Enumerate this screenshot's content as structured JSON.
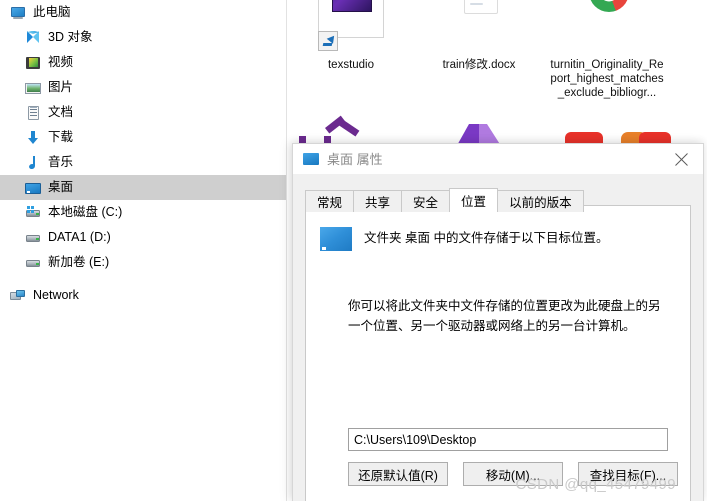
{
  "explorer": {
    "nav_pane": {
      "items": [
        {
          "label": "此电脑",
          "icon": "monitor-icon",
          "level": 0,
          "selected": false
        },
        {
          "label": "3D 对象",
          "icon": "cube-icon",
          "level": 1,
          "selected": false
        },
        {
          "label": "视频",
          "icon": "video-icon",
          "level": 1,
          "selected": false
        },
        {
          "label": "图片",
          "icon": "picture-icon",
          "level": 1,
          "selected": false
        },
        {
          "label": "文档",
          "icon": "document-icon",
          "level": 1,
          "selected": false
        },
        {
          "label": "下载",
          "icon": "download-icon",
          "level": 1,
          "selected": false
        },
        {
          "label": "音乐",
          "icon": "music-icon",
          "level": 1,
          "selected": false
        },
        {
          "label": "桌面",
          "icon": "desktop-icon",
          "level": 1,
          "selected": true
        },
        {
          "label": "本地磁盘 (C:)",
          "icon": "system-drive-icon",
          "level": 1,
          "selected": false
        },
        {
          "label": "DATA1 (D:)",
          "icon": "drive-icon",
          "level": 1,
          "selected": false
        },
        {
          "label": "新加卷 (E:)",
          "icon": "drive-icon",
          "level": 1,
          "selected": false
        },
        {
          "label": "Network",
          "icon": "network-icon",
          "level": 0,
          "selected": false
        }
      ]
    },
    "content_pane": {
      "files": [
        {
          "name": "texstudio",
          "icon": "texstudio-shortcut-icon",
          "selected": true
        },
        {
          "name": "train修改.docx",
          "icon": "word-document-icon",
          "selected": false
        },
        {
          "name": "turnitin_Originality_Report_highest_matches_exclude_bibliogr...",
          "icon": "chrome-html-document-icon",
          "selected": false
        }
      ]
    }
  },
  "dialog": {
    "title": "桌面 属性",
    "title_icon": "desktop-folder-icon",
    "close_label": "✕",
    "tabs": [
      {
        "label": "常规",
        "active": false
      },
      {
        "label": "共享",
        "active": false
      },
      {
        "label": "安全",
        "active": false
      },
      {
        "label": "位置",
        "active": true
      },
      {
        "label": "以前的版本",
        "active": false
      }
    ],
    "location": {
      "folder_icon": "desktop-folder-icon",
      "heading": "文件夹 桌面 中的文件存储于以下目标位置。",
      "description": "你可以将此文件夹中文件存储的位置更改为此硬盘上的另一个位置、另一个驱动器或网络上的另一台计算机。",
      "path_value": "C:\\Users\\109\\Desktop",
      "path_placeholder": "",
      "buttons": [
        {
          "label": "还原默认值(R)",
          "name": "restore-default-button"
        },
        {
          "label": "移动(M)...",
          "name": "move-button"
        },
        {
          "label": "查找目标(F)...",
          "name": "find-target-button"
        }
      ]
    }
  },
  "watermark": {
    "text": "CSDN @qq_45479499"
  },
  "colors": {
    "accent_blue": "#1878c0",
    "selection_gray": "#cfcfcf",
    "dialog_bg": "#f0f0f0",
    "button_bg": "#efefef",
    "watermark_gray": "#c9c9c9"
  }
}
